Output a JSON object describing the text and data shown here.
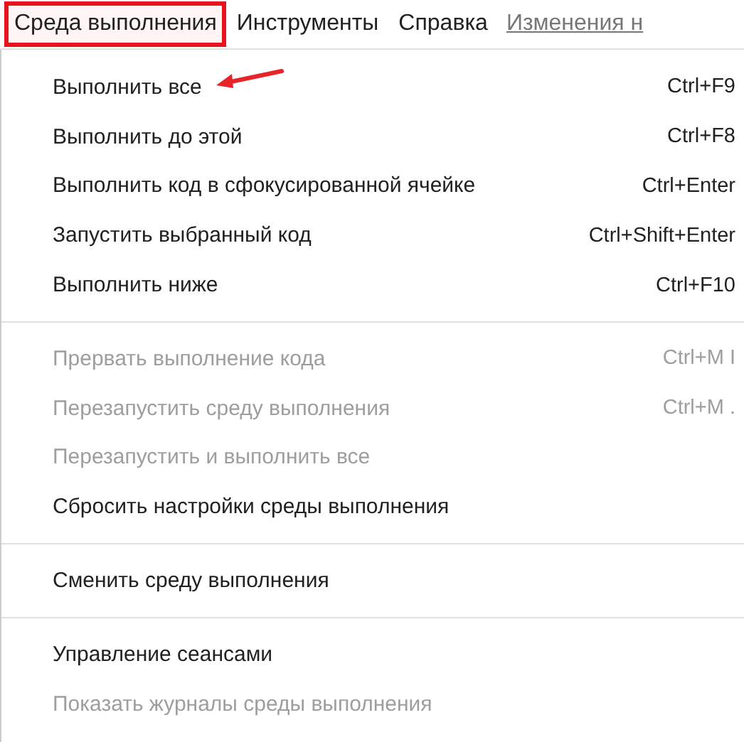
{
  "menu_bar": [
    {
      "label": "Среда выполнения",
      "highlighted": true,
      "kind": "menu"
    },
    {
      "label": "Инструменты",
      "highlighted": false,
      "kind": "menu"
    },
    {
      "label": "Справка",
      "highlighted": false,
      "kind": "menu"
    },
    {
      "label": "Изменения н",
      "kind": "link"
    }
  ],
  "menu": {
    "groups": [
      [
        {
          "label": "Выполнить все",
          "shortcut": "Ctrl+F9",
          "disabled": false,
          "pointed": true
        },
        {
          "label": "Выполнить до этой",
          "shortcut": "Ctrl+F8",
          "disabled": false,
          "pointed": false
        },
        {
          "label": "Выполнить код в сфокусированной ячейке",
          "shortcut": "Ctrl+Enter",
          "disabled": false,
          "pointed": false
        },
        {
          "label": "Запустить выбранный код",
          "shortcut": "Ctrl+Shift+Enter",
          "disabled": false,
          "pointed": false
        },
        {
          "label": "Выполнить ниже",
          "shortcut": "Ctrl+F10",
          "disabled": false,
          "pointed": false
        }
      ],
      [
        {
          "label": "Прервать выполнение кода",
          "shortcut": "Ctrl+M I",
          "disabled": true,
          "pointed": false
        },
        {
          "label": "Перезапустить среду выполнения",
          "shortcut": "Ctrl+M .",
          "disabled": true,
          "pointed": false
        },
        {
          "label": "Перезапустить и выполнить все",
          "disabled": true,
          "pointed": false
        },
        {
          "label": "Сбросить настройки среды выполнения",
          "disabled": false,
          "pointed": false
        }
      ],
      [
        {
          "label": "Сменить среду выполнения",
          "disabled": false,
          "pointed": false
        }
      ],
      [
        {
          "label": "Управление сеансами",
          "disabled": false,
          "pointed": false
        },
        {
          "label": "Показать журналы среды выполнения",
          "disabled": true,
          "pointed": false
        }
      ]
    ]
  }
}
